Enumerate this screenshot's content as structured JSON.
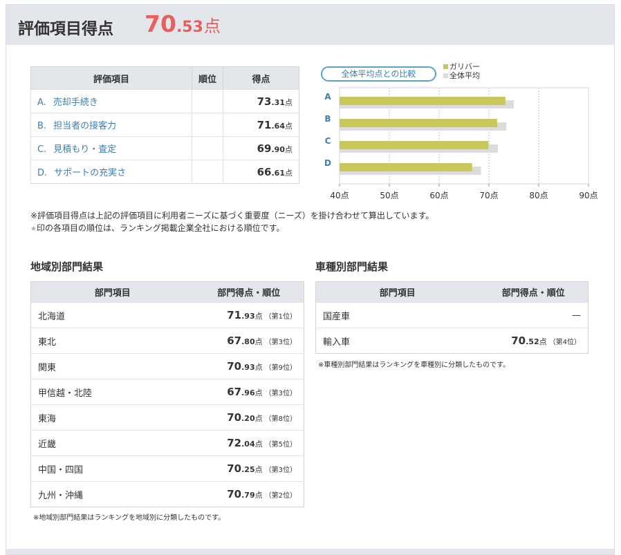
{
  "header": {
    "title": "評価項目得点",
    "total_int": "70",
    "total_dec": ".53",
    "total_unit": "点"
  },
  "eval_table": {
    "headers": [
      "評価項目",
      "順位",
      "得点"
    ],
    "rows": [
      {
        "letter": "A.",
        "label": "売却手続き",
        "rank": "",
        "int": "73",
        "dec": ".31",
        "unit": "点"
      },
      {
        "letter": "B.",
        "label": "担当者の接客力",
        "rank": "",
        "int": "71",
        "dec": ".64",
        "unit": "点"
      },
      {
        "letter": "C.",
        "label": "見積もり・査定",
        "rank": "",
        "int": "69",
        "dec": ".90",
        "unit": "点"
      },
      {
        "letter": "D.",
        "label": "サポートの充実さ",
        "rank": "",
        "int": "66",
        "dec": ".61",
        "unit": "点"
      }
    ]
  },
  "compare_button": "全体平均点との比較",
  "legend": [
    {
      "label": "ガリバー",
      "color": "#c9c75a"
    },
    {
      "label": "全体平均",
      "color": "#dcdcdc"
    }
  ],
  "chart_data": {
    "type": "bar",
    "orientation": "horizontal",
    "categories": [
      "A",
      "B",
      "C",
      "D"
    ],
    "series": [
      {
        "name": "ガリバー",
        "values": [
          73.31,
          71.64,
          69.9,
          66.61
        ],
        "color": "#c9c75a"
      },
      {
        "name": "全体平均",
        "values": [
          75.0,
          73.5,
          71.8,
          68.4
        ],
        "color": "#dcdcdc"
      }
    ],
    "xlim": [
      40,
      90
    ],
    "xticks": [
      "40点",
      "50点",
      "60点",
      "70点",
      "80点",
      "90点"
    ],
    "grid": true,
    "legend_position": "top-right"
  },
  "notes": {
    "line1": "※評価項目得点は上記の評価項目に利用者ニーズに基づく重要度（ニーズ）を掛け合わせて算出しています。",
    "line2_star": "★",
    "line2": "印の各項目の順位は、ランキング掲載企業全社における順位です。"
  },
  "regional": {
    "title": "地域別部門結果",
    "headers": [
      "部門項目",
      "部門得点・順位"
    ],
    "rows": [
      {
        "name": "北海道",
        "int": "71",
        "dec": ".93",
        "unit": "点",
        "rank": "（第1位）"
      },
      {
        "name": "東北",
        "int": "67",
        "dec": ".80",
        "unit": "点",
        "rank": "（第3位）"
      },
      {
        "name": "関東",
        "int": "70",
        "dec": ".93",
        "unit": "点",
        "rank": "（第9位）"
      },
      {
        "name": "甲信越・北陸",
        "int": "67",
        "dec": ".96",
        "unit": "点",
        "rank": "（第3位）"
      },
      {
        "name": "東海",
        "int": "70",
        "dec": ".20",
        "unit": "点",
        "rank": "（第8位）"
      },
      {
        "name": "近畿",
        "int": "72",
        "dec": ".04",
        "unit": "点",
        "rank": "（第5位）"
      },
      {
        "name": "中国・四国",
        "int": "70",
        "dec": ".25",
        "unit": "点",
        "rank": "（第3位）"
      },
      {
        "name": "九州・沖縄",
        "int": "70",
        "dec": ".79",
        "unit": "点",
        "rank": "（第2位）"
      }
    ],
    "note": "※地域別部門結果はランキングを地域別に分類したものです。"
  },
  "vehicle": {
    "title": "車種別部門結果",
    "headers": [
      "部門項目",
      "部門得点・順位"
    ],
    "rows": [
      {
        "name": "国産車",
        "dash": "—"
      },
      {
        "name": "輸入車",
        "int": "70",
        "dec": ".52",
        "unit": "点",
        "rank": "（第4位）"
      }
    ],
    "note": "※車種別部門結果はランキングを車種別に分類したものです。"
  }
}
